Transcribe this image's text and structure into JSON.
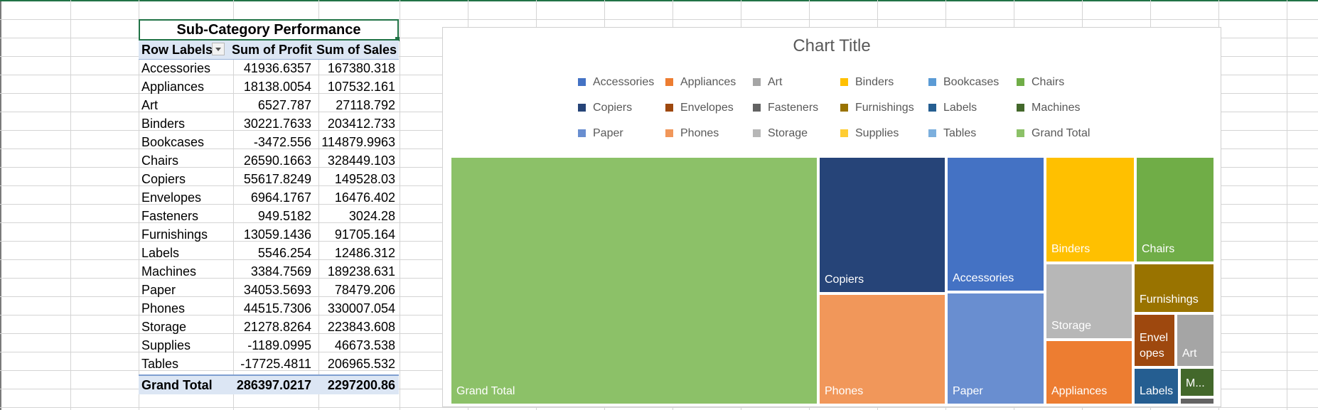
{
  "pivot": {
    "title": "Sub-Category Performance",
    "headers": [
      "Row Labels",
      "Sum of Profit",
      "Sum of Sales"
    ],
    "rows": [
      {
        "label": "Accessories",
        "profit": "41936.6357",
        "sales": "167380.318"
      },
      {
        "label": "Appliances",
        "profit": "18138.0054",
        "sales": "107532.161"
      },
      {
        "label": "Art",
        "profit": "6527.787",
        "sales": "27118.792"
      },
      {
        "label": "Binders",
        "profit": "30221.7633",
        "sales": "203412.733"
      },
      {
        "label": "Bookcases",
        "profit": "-3472.556",
        "sales": "114879.9963"
      },
      {
        "label": "Chairs",
        "profit": "26590.1663",
        "sales": "328449.103"
      },
      {
        "label": "Copiers",
        "profit": "55617.8249",
        "sales": "149528.03"
      },
      {
        "label": "Envelopes",
        "profit": "6964.1767",
        "sales": "16476.402"
      },
      {
        "label": "Fasteners",
        "profit": "949.5182",
        "sales": "3024.28"
      },
      {
        "label": "Furnishings",
        "profit": "13059.1436",
        "sales": "91705.164"
      },
      {
        "label": "Labels",
        "profit": "5546.254",
        "sales": "12486.312"
      },
      {
        "label": "Machines",
        "profit": "3384.7569",
        "sales": "189238.631"
      },
      {
        "label": "Paper",
        "profit": "34053.5693",
        "sales": "78479.206"
      },
      {
        "label": "Phones",
        "profit": "44515.7306",
        "sales": "330007.054"
      },
      {
        "label": "Storage",
        "profit": "21278.8264",
        "sales": "223843.608"
      },
      {
        "label": "Supplies",
        "profit": "-1189.0995",
        "sales": "46673.538"
      },
      {
        "label": "Tables",
        "profit": "-17725.4811",
        "sales": "206965.532"
      }
    ],
    "total": {
      "label": "Grand Total",
      "profit": "286397.0217",
      "sales": "2297200.86"
    }
  },
  "chart_data": {
    "type": "treemap",
    "title": "Chart Title",
    "metric": "Sum of Profit",
    "legend_position": "top",
    "legend": [
      {
        "name": "Accessories",
        "color": "#4472c4"
      },
      {
        "name": "Appliances",
        "color": "#ed7d31"
      },
      {
        "name": "Art",
        "color": "#a5a5a5"
      },
      {
        "name": "Binders",
        "color": "#ffc000"
      },
      {
        "name": "Bookcases",
        "color": "#5b9bd5"
      },
      {
        "name": "Chairs",
        "color": "#70ad47"
      },
      {
        "name": "Copiers",
        "color": "#264478"
      },
      {
        "name": "Envelopes",
        "color": "#9e480e"
      },
      {
        "name": "Fasteners",
        "color": "#636363"
      },
      {
        "name": "Furnishings",
        "color": "#997300"
      },
      {
        "name": "Labels",
        "color": "#255e91"
      },
      {
        "name": "Machines",
        "color": "#43682b"
      },
      {
        "name": "Paper",
        "color": "#698ed0"
      },
      {
        "name": "Phones",
        "color": "#f1975a"
      },
      {
        "name": "Storage",
        "color": "#b7b7b7"
      },
      {
        "name": "Supplies",
        "color": "#ffcd33"
      },
      {
        "name": "Tables",
        "color": "#7cafdd"
      },
      {
        "name": "Grand Total",
        "color": "#8cc168"
      }
    ],
    "tiles": [
      {
        "name": "Grand Total",
        "label": "Grand Total",
        "value": 286397.0217,
        "color": "#8cc168"
      },
      {
        "name": "Copiers",
        "label": "Copiers",
        "value": 55617.8249,
        "color": "#264478"
      },
      {
        "name": "Phones",
        "label": "Phones",
        "value": 44515.7306,
        "color": "#f1975a"
      },
      {
        "name": "Accessories",
        "label": "Accessories",
        "value": 41936.6357,
        "color": "#4472c4"
      },
      {
        "name": "Paper",
        "label": "Paper",
        "value": 34053.5693,
        "color": "#698ed0"
      },
      {
        "name": "Binders",
        "label": "Binders",
        "value": 30221.7633,
        "color": "#ffc000"
      },
      {
        "name": "Chairs",
        "label": "Chairs",
        "value": 26590.1663,
        "color": "#70ad47"
      },
      {
        "name": "Storage",
        "label": "Storage",
        "value": 21278.8264,
        "color": "#b7b7b7"
      },
      {
        "name": "Appliances",
        "label": "Appliances",
        "value": 18138.0054,
        "color": "#ed7d31"
      },
      {
        "name": "Furnishings",
        "label": "Furnishings",
        "value": 13059.1436,
        "color": "#997300"
      },
      {
        "name": "Envelopes",
        "label": "Envel opes",
        "value": 6964.1767,
        "color": "#9e480e"
      },
      {
        "name": "Art",
        "label": "Art",
        "value": 6527.787,
        "color": "#a5a5a5"
      },
      {
        "name": "Labels",
        "label": "Labels",
        "value": 5546.254,
        "color": "#255e91"
      },
      {
        "name": "Machines",
        "label": "M...",
        "value": 3384.7569,
        "color": "#43682b"
      },
      {
        "name": "Fasteners",
        "label": "",
        "value": 949.5182,
        "color": "#636363"
      }
    ]
  }
}
